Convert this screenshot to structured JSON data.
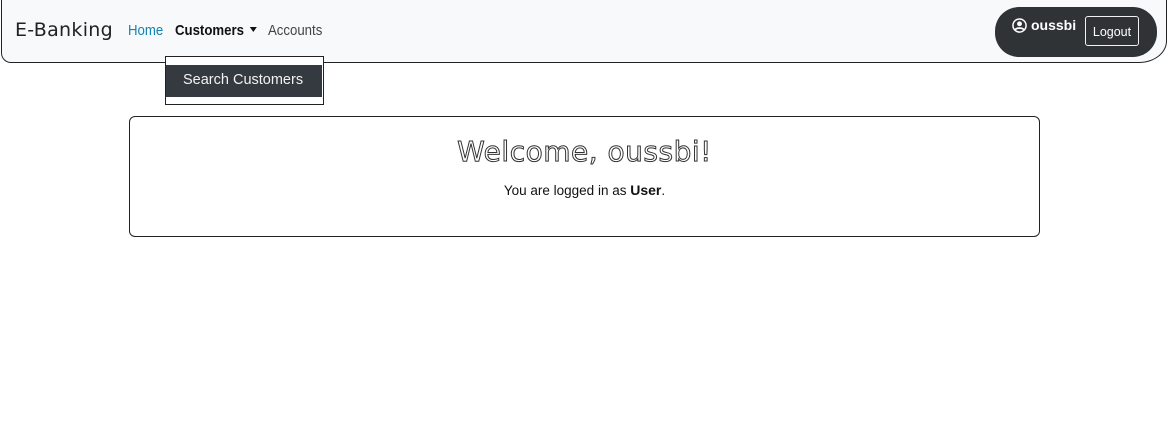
{
  "navbar": {
    "brand": "E-Banking",
    "links": {
      "home": "Home",
      "customers": "Customers",
      "accounts": "Accounts"
    },
    "active_link_color": "#0d84b5",
    "customers_dropdown": {
      "items": [
        "Search Customers"
      ]
    },
    "user": {
      "icon": "user-circle-icon",
      "name": "oussbi",
      "logout_label": "Logout"
    }
  },
  "welcome": {
    "title": "Welcome, oussbi!",
    "subtitle_prefix": "You are logged in as ",
    "role": "User",
    "subtitle_suffix": "."
  }
}
